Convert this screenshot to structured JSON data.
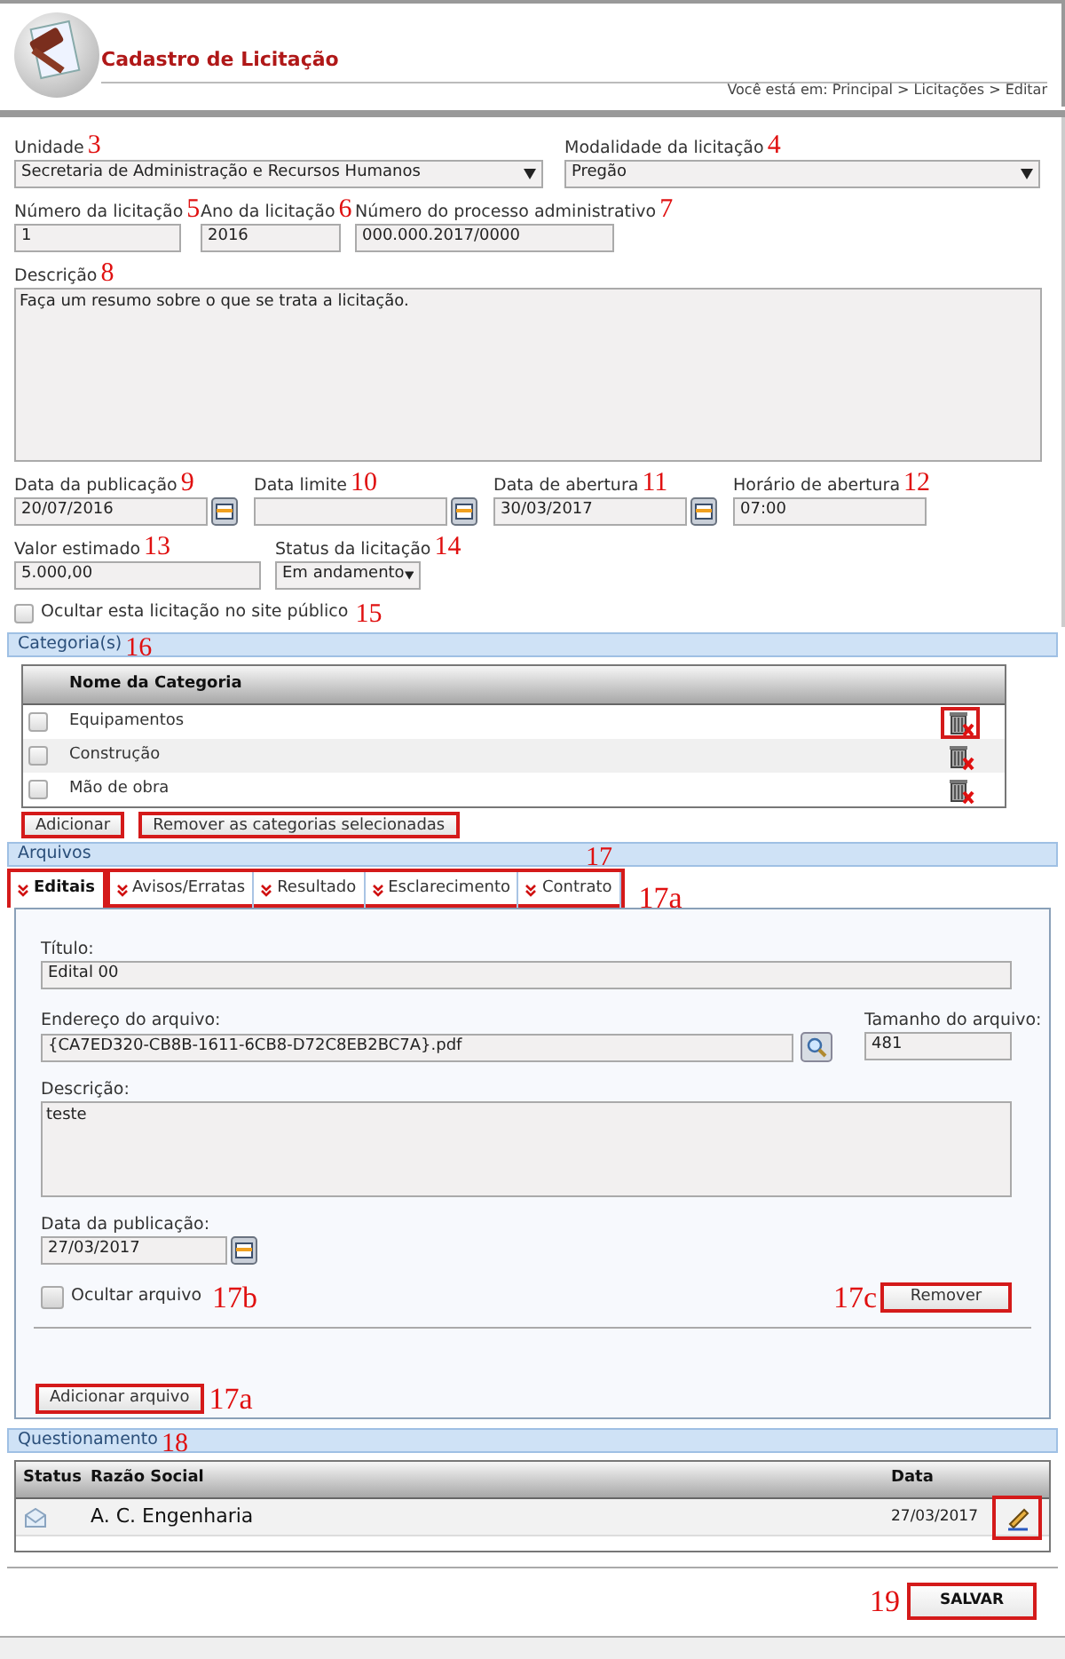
{
  "header": {
    "title": "Cadastro de Licitação",
    "breadcrumb": "Você está em: Principal > Licitações > Editar"
  },
  "form_rows": [
    [
      {
        "kind": "select",
        "label": "Unidade",
        "annotation": "3",
        "value": "Secretaria de Administração e Recursos Humanos"
      },
      {
        "kind": "select",
        "label": "Modalidade da licitação",
        "annotation": "4",
        "value": "Pregão"
      }
    ],
    [
      {
        "kind": "input",
        "label": "Número da licitação",
        "annotation": "5",
        "value": "1"
      },
      {
        "kind": "input",
        "label": "Ano da licitação",
        "annotation": "6",
        "value": "2016"
      },
      {
        "kind": "input",
        "label": "Número do processo administrativo",
        "annotation": "7",
        "value": "000.000.2017/0000"
      }
    ],
    [
      {
        "kind": "textarea",
        "label": "Descrição",
        "annotation": "8",
        "value": "Faça um resumo sobre o que se trata a licitação."
      }
    ],
    [
      {
        "kind": "date",
        "label": "Data da publicação",
        "annotation": "9",
        "value": "20/07/2016"
      },
      {
        "kind": "date",
        "label": "Data limite",
        "annotation": "10"
      },
      {
        "kind": "date",
        "label": "Data de abertura",
        "annotation": "11",
        "value": "30/03/2017"
      },
      {
        "kind": "input",
        "label": "Horário de abertura",
        "annotation": "12",
        "value": "07:00"
      }
    ],
    [
      {
        "kind": "input",
        "label": "Valor estimado",
        "annotation": "13",
        "value": "5.000,00"
      },
      {
        "kind": "select",
        "label": "Status da licitação",
        "annotation": "14",
        "value": "Em andamento"
      }
    ]
  ],
  "hide_public": {
    "label": "Ocultar esta licitação no site público",
    "annotation": "15",
    "checked": false
  },
  "categories": {
    "title": "Categoria(s)",
    "annotation": "16",
    "columns": [
      "Nome da Categoria"
    ],
    "rows": [
      {
        "name": "Equipamentos",
        "checked": false,
        "outlined": true
      },
      {
        "name": "Construção",
        "checked": false,
        "outlined": false
      },
      {
        "name": "Mão de obra",
        "checked": false,
        "outlined": false
      }
    ],
    "buttons": [
      {
        "label": "Adicionar",
        "outlined": true
      },
      {
        "label": "Remover as categorias selecionadas",
        "outlined": true
      }
    ]
  },
  "files": {
    "title": "Arquivos",
    "annotation": "17",
    "tabs_annotation": "17a",
    "tabs_outlined": true,
    "tabs": [
      {
        "label": "Editais",
        "selected": true
      },
      {
        "label": "Avisos/Erratas",
        "selected": false
      },
      {
        "label": "Resultado",
        "selected": false
      },
      {
        "label": "Esclarecimento",
        "selected": false
      },
      {
        "label": "Contrato",
        "selected": false
      }
    ],
    "title_field": {
      "label": "Título:",
      "value": "Edital 00"
    },
    "address_field": {
      "label": "Endereço do arquivo:",
      "value": "{CA7ED320-CB8B-1611-6CB8-D72C8EB2BC7A}.pdf"
    },
    "size_field": {
      "label": "Tamanho do arquivo:",
      "value": "481"
    },
    "description_field": {
      "label": "Descrição:",
      "value": "teste"
    },
    "date_field": {
      "label": "Data da publicação:",
      "value": "27/03/2017"
    },
    "hide_file": {
      "label": "Ocultar arquivo",
      "annotation": "17b",
      "checked": false
    },
    "remove_button": {
      "label": "Remover",
      "annotation": "17c",
      "outlined": true
    },
    "add_button": {
      "label": "Adicionar arquivo",
      "annotation": "17a",
      "outlined": true
    }
  },
  "questions": {
    "title": "Questionamento",
    "annotation": "18",
    "columns": [
      "Status",
      "Razão Social",
      "Data"
    ],
    "rows": [
      {
        "company": "A. C. Engenharia",
        "date": "27/03/2017",
        "outlined": true
      }
    ]
  },
  "save_button": {
    "label": "SALVAR",
    "annotation": "19",
    "outlined": true
  }
}
